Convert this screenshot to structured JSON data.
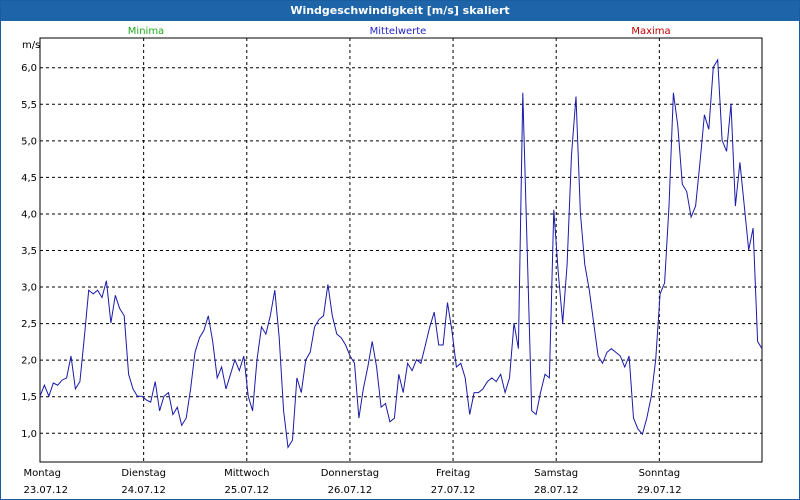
{
  "window": {
    "title": "Windgeschwindigkeit [m/s] skaliert"
  },
  "legend": [
    {
      "label": "Minima",
      "color": "#22aa22"
    },
    {
      "label": "Mittelwerte",
      "color": "#2222cc"
    },
    {
      "label": "Maxima",
      "color": "#c00000"
    }
  ],
  "chart_data": {
    "type": "line",
    "title": "Windgeschwindigkeit [m/s] skaliert",
    "ylabel": "m/s",
    "xlabel": "",
    "ylim": [
      0.6,
      6.4
    ],
    "xlim": [
      0,
      7
    ],
    "grid": true,
    "yticks": [
      "1,0",
      "1,5",
      "2,0",
      "2,5",
      "3,0",
      "3,5",
      "4,0",
      "4,5",
      "5,0",
      "5,5",
      "6,0"
    ],
    "ytick_values": [
      1.0,
      1.5,
      2.0,
      2.5,
      3.0,
      3.5,
      4.0,
      4.5,
      5.0,
      5.5,
      6.0
    ],
    "xticks": [
      {
        "day": "Montag",
        "date": "23.07.12"
      },
      {
        "day": "Dienstag",
        "date": "24.07.12"
      },
      {
        "day": "Mittwoch",
        "date": "25.07.12"
      },
      {
        "day": "Donnerstag",
        "date": "26.07.12"
      },
      {
        "day": "Freitag",
        "date": "27.07.12"
      },
      {
        "day": "Samstag",
        "date": "28.07.12"
      },
      {
        "day": "Sonntag",
        "date": "29.07.12"
      }
    ],
    "series": [
      {
        "name": "Mittelwerte",
        "color": "#1a1aa8",
        "values": [
          1.5,
          1.65,
          1.5,
          1.68,
          1.65,
          1.72,
          1.75,
          2.05,
          1.6,
          1.7,
          2.3,
          2.95,
          2.9,
          2.95,
          2.85,
          3.08,
          2.5,
          2.88,
          2.7,
          2.6,
          1.8,
          1.6,
          1.5,
          1.5,
          1.45,
          1.42,
          1.7,
          1.3,
          1.5,
          1.55,
          1.25,
          1.35,
          1.1,
          1.2,
          1.6,
          2.1,
          2.3,
          2.4,
          2.6,
          2.25,
          1.75,
          1.9,
          1.6,
          1.8,
          2.0,
          1.85,
          2.05,
          1.5,
          1.3,
          2.0,
          2.45,
          2.35,
          2.6,
          2.95,
          2.3,
          1.3,
          0.8,
          0.9,
          1.75,
          1.55,
          2.0,
          2.1,
          2.45,
          2.55,
          2.6,
          3.03,
          2.6,
          2.35,
          2.3,
          2.2,
          2.05,
          1.95,
          1.2,
          1.6,
          1.9,
          2.25,
          1.9,
          1.35,
          1.4,
          1.15,
          1.2,
          1.8,
          1.55,
          1.95,
          1.85,
          2.0,
          1.95,
          2.2,
          2.45,
          2.65,
          2.2,
          2.2,
          2.78,
          2.4,
          1.9,
          1.95,
          1.75,
          1.25,
          1.55,
          1.55,
          1.6,
          1.7,
          1.75,
          1.7,
          1.8,
          1.55,
          1.75,
          2.5,
          2.15,
          5.65,
          3.5,
          1.3,
          1.25,
          1.55,
          1.8,
          1.75,
          4.05,
          3.2,
          2.5,
          3.3,
          4.8,
          5.6,
          4.0,
          3.3,
          2.95,
          2.5,
          2.05,
          1.95,
          2.1,
          2.15,
          2.1,
          2.05,
          1.9,
          2.05,
          1.2,
          1.05,
          0.98,
          1.2,
          1.5,
          2.0,
          2.9,
          3.05,
          4.1,
          5.65,
          5.2,
          4.4,
          4.3,
          3.95,
          4.1,
          4.7,
          5.35,
          5.15,
          6.0,
          6.1,
          5.0,
          4.85,
          5.5,
          4.1,
          4.7,
          4.1,
          3.5,
          3.8,
          2.25,
          2.15
        ]
      }
    ]
  }
}
